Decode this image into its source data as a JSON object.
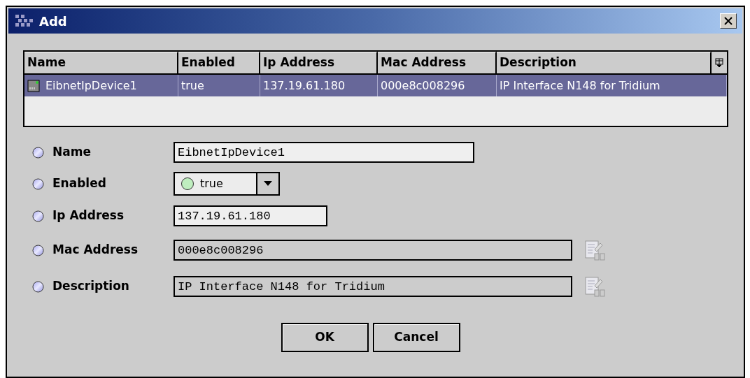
{
  "window": {
    "title": "Add"
  },
  "table": {
    "columns": [
      "Name",
      "Enabled",
      "Ip Address",
      "Mac Address",
      "Description"
    ],
    "rows": [
      {
        "selected": true,
        "cells": [
          "EibnetIpDevice1",
          "true",
          "137.19.61.180",
          "000e8c008296",
          "IP Interface N148 for Tridium"
        ]
      }
    ]
  },
  "form": [
    {
      "label": "Name",
      "kind": "text",
      "value": "EibnetIpDevice1",
      "editable": true,
      "editor_button": false
    },
    {
      "label": "Enabled",
      "kind": "select",
      "value": "true",
      "editable": true,
      "editor_button": false
    },
    {
      "label": "Ip Address",
      "kind": "text",
      "value": "137.19.61.180",
      "editable": true,
      "editor_button": false
    },
    {
      "label": "Mac Address",
      "kind": "text",
      "value": "000e8c008296",
      "editable": false,
      "editor_button": true
    },
    {
      "label": "Description",
      "kind": "text",
      "value": "IP Interface N148 for Tridium",
      "editable": false,
      "editor_button": true
    }
  ],
  "buttons": [
    "OK",
    "Cancel"
  ]
}
